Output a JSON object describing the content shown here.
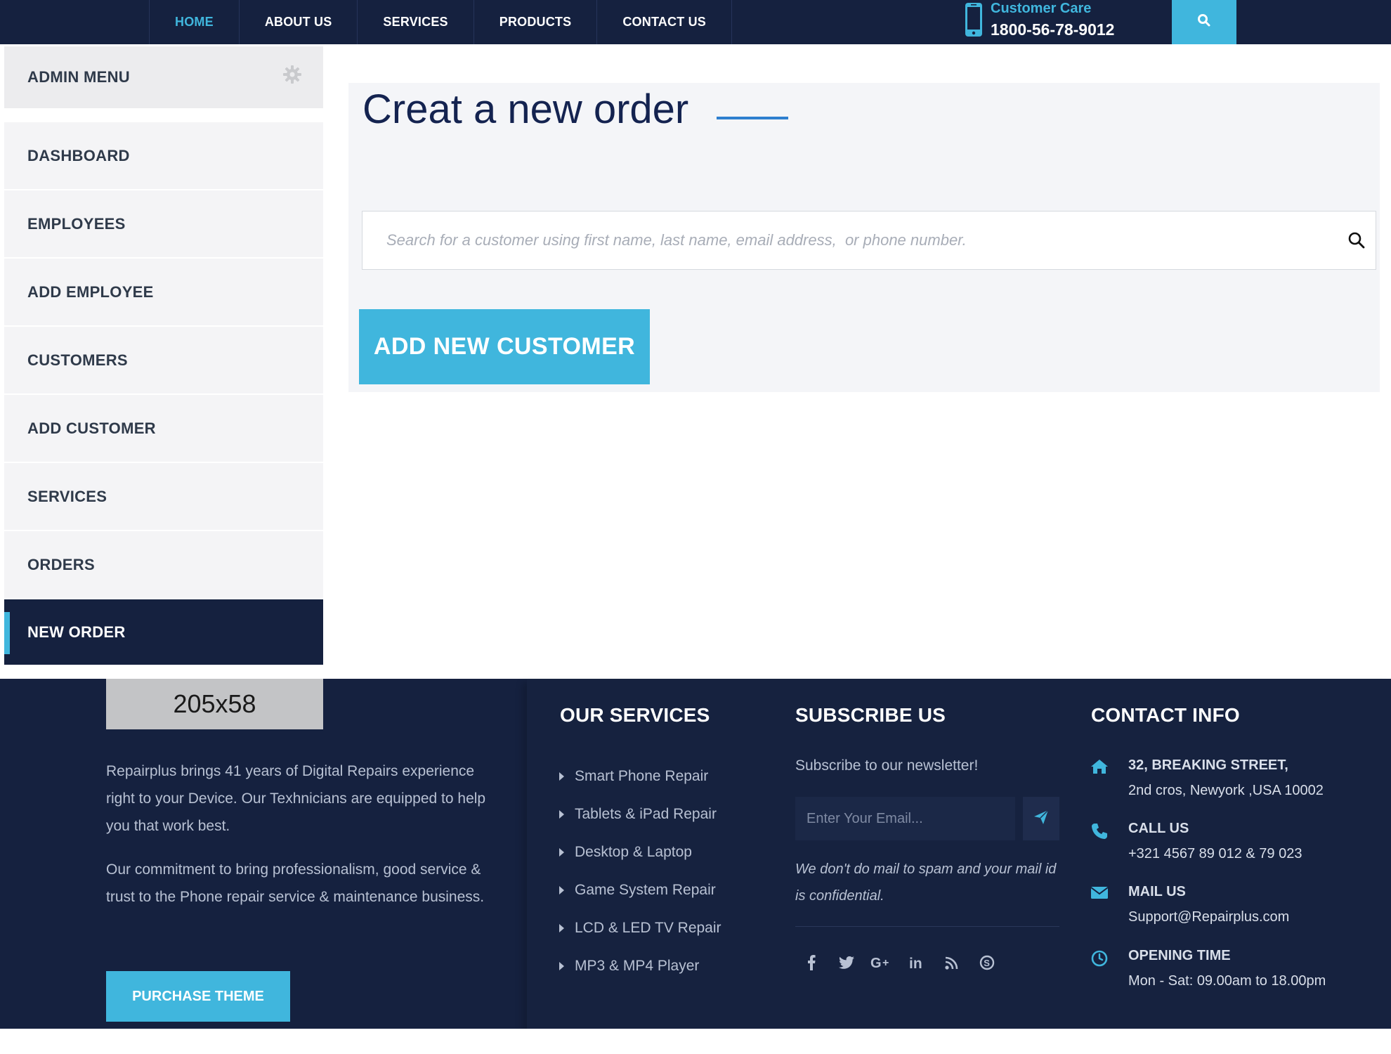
{
  "nav": {
    "items": [
      {
        "label": "HOME",
        "active": true
      },
      {
        "label": "ABOUT US"
      },
      {
        "label": "SERVICES"
      },
      {
        "label": "PRODUCTS"
      },
      {
        "label": "CONTACT US"
      }
    ],
    "care_label": "Customer Care",
    "care_number": "1800-56-78-9012",
    "search_icon": "search-icon"
  },
  "sidebar": {
    "title": "ADMIN MENU",
    "settings_icon": "gear-icon",
    "items": [
      {
        "label": "DASHBOARD"
      },
      {
        "label": "EMPLOYEES"
      },
      {
        "label": "ADD EMPLOYEE"
      },
      {
        "label": "CUSTOMERS"
      },
      {
        "label": "ADD CUSTOMER"
      },
      {
        "label": "SERVICES"
      },
      {
        "label": "ORDERS"
      },
      {
        "label": "NEW ORDER",
        "active": true
      }
    ]
  },
  "main": {
    "title": "Creat a new order",
    "search_placeholder": "Search for a customer using first name, last name, email address,  or phone number.",
    "add_button": "ADD NEW CUSTOMER"
  },
  "footer": {
    "logo_placeholder": "205x58",
    "about": [
      "Repairplus brings 41 years of Digital Repairs experience right to your Device. Our Texhnicians are equipped to help you that work best.",
      "Our commitment to bring professionalism, good service & trust to the Phone repair service & maintenance business."
    ],
    "purchase_button": "PURCHASE THEME",
    "services_heading": "OUR SERVICES",
    "services": [
      "Smart Phone Repair",
      "Tablets & iPad Repair",
      "Desktop & Laptop",
      "Game System Repair",
      "LCD & LED TV Repair",
      "MP3 & MP4 Player"
    ],
    "subscribe_heading": "SUBSCRIBE US",
    "subscribe_text": "Subscribe to our newsletter!",
    "email_placeholder": "Enter Your Email...",
    "spam_note": "We don't do mail to spam and your mail id is confidential.",
    "socials": [
      "facebook-icon",
      "twitter-icon",
      "google-plus-icon",
      "linkedin-icon",
      "rss-icon",
      "skype-icon"
    ],
    "contact_heading": "CONTACT INFO",
    "contact": {
      "address_1": "32, BREAKING STREET,",
      "address_2": "2nd cros, Newyork ,USA 10002",
      "call_title": "CALL US",
      "call_value": "+321 4567 89 012 & 79 023",
      "mail_title": "MAIL US",
      "mail_value": "Support@Repairplus.com",
      "hours_title": "OPENING TIME",
      "hours_value": "Mon - Sat: 09.00am to 18.00pm"
    }
  },
  "colors": {
    "navy": "#15213f",
    "accent": "#40b6dd",
    "title": "#142350"
  }
}
